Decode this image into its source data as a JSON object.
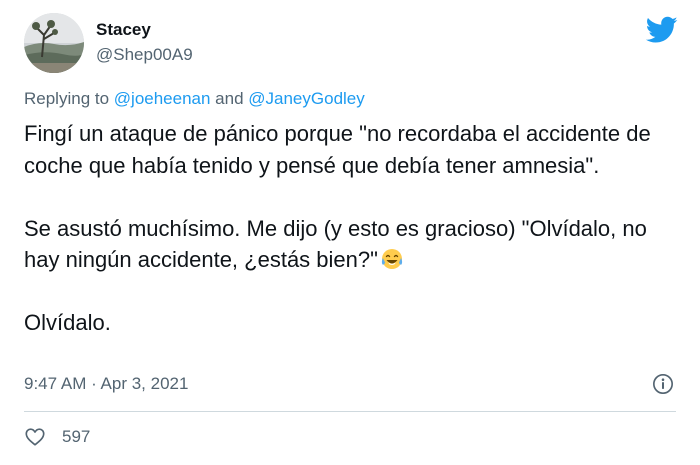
{
  "author": {
    "display_name": "Stacey",
    "handle": "@Shep00A9",
    "avatar_icon": "landscape-photo-avatar"
  },
  "brand": {
    "icon": "twitter-bird-icon",
    "color": "#1d9bf0"
  },
  "replying": {
    "prefix": "Replying to ",
    "mention_1": "@joeheenan",
    "conjunction": " and ",
    "mention_2": "@JaneyGodley",
    "mention_color": "#1d9bf0"
  },
  "tweet": {
    "paragraph_1": "Fingí un ataque de pánico porque \"no recordaba el accidente de coche que había tenido y pensé que debía tener amnesia\".",
    "paragraph_2": "Se asustó muchísimo. Me dijo (y esto es gracioso) \"Olvídalo, no hay ningún accidente, ¿estás bien?\"",
    "paragraph_2_emoji": "tears-of-joy-emoji",
    "paragraph_3": "Olvídalo."
  },
  "meta": {
    "timestamp": "9:47 AM · Apr 3, 2021",
    "info_icon": "info-icon"
  },
  "actions": {
    "like_icon": "heart-icon",
    "like_count": "597"
  }
}
